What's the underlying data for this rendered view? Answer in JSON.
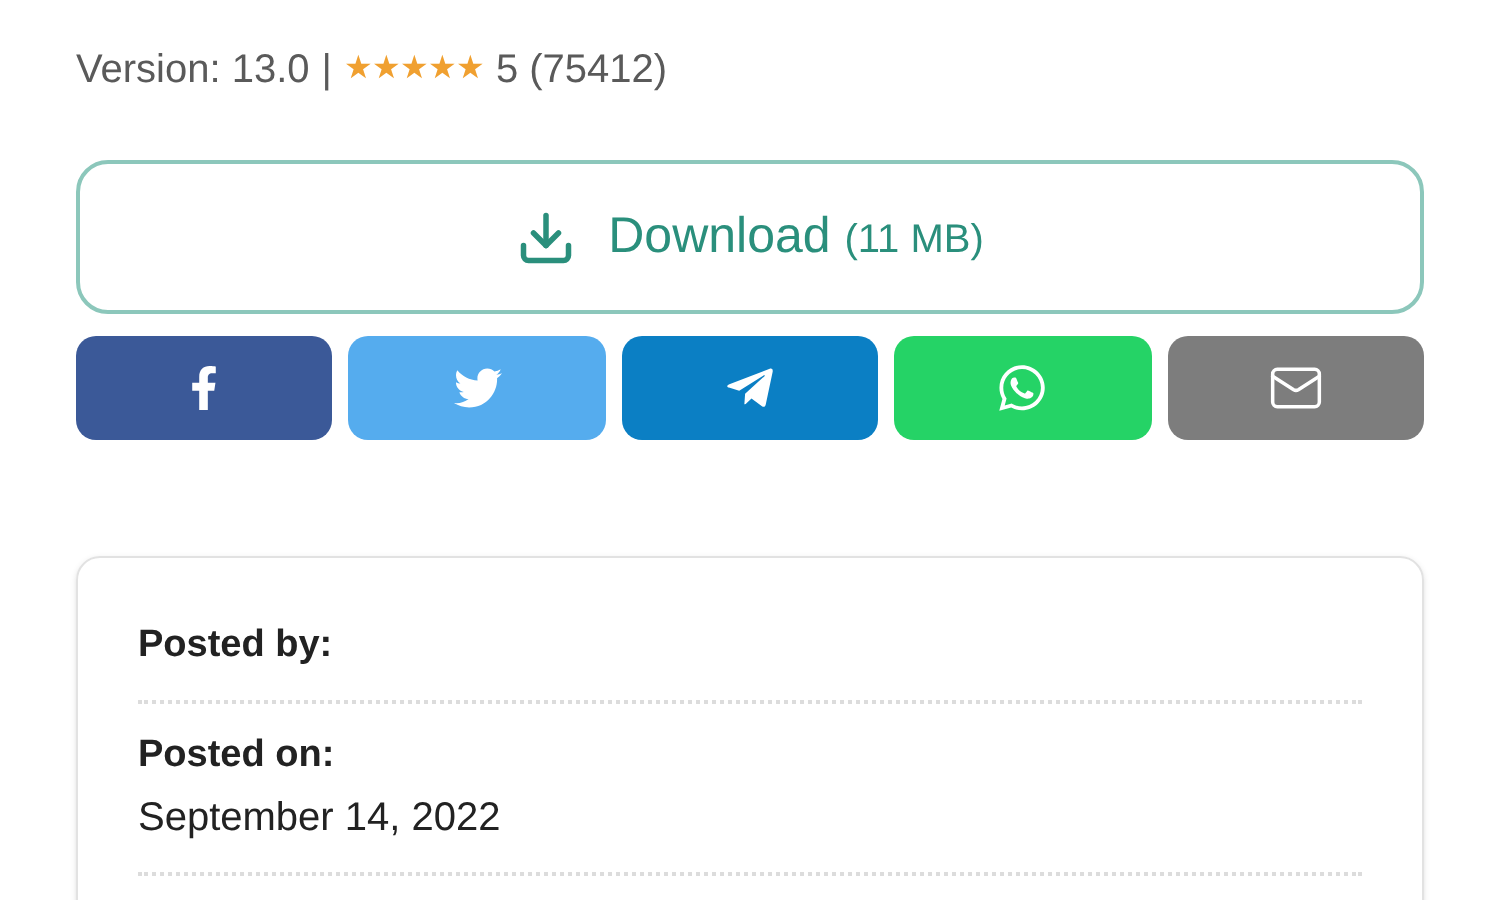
{
  "meta": {
    "version": "Version: 13.0",
    "separator": "|",
    "stars": 5,
    "rating": "5 (75412)"
  },
  "download": {
    "label": "Download",
    "size": "(11 MB)"
  },
  "share_buttons": [
    {
      "kind": "facebook",
      "color": "#3b5998"
    },
    {
      "kind": "twitter",
      "color": "#55acee"
    },
    {
      "kind": "telegram",
      "color": "#0b7fc4"
    },
    {
      "kind": "whatsapp",
      "color": "#25d366"
    },
    {
      "kind": "email",
      "color": "#7d7d7d"
    }
  ],
  "details": [
    {
      "label": "Posted by:"
    },
    {
      "label": "Posted on:",
      "value": "September 14, 2022"
    }
  ]
}
